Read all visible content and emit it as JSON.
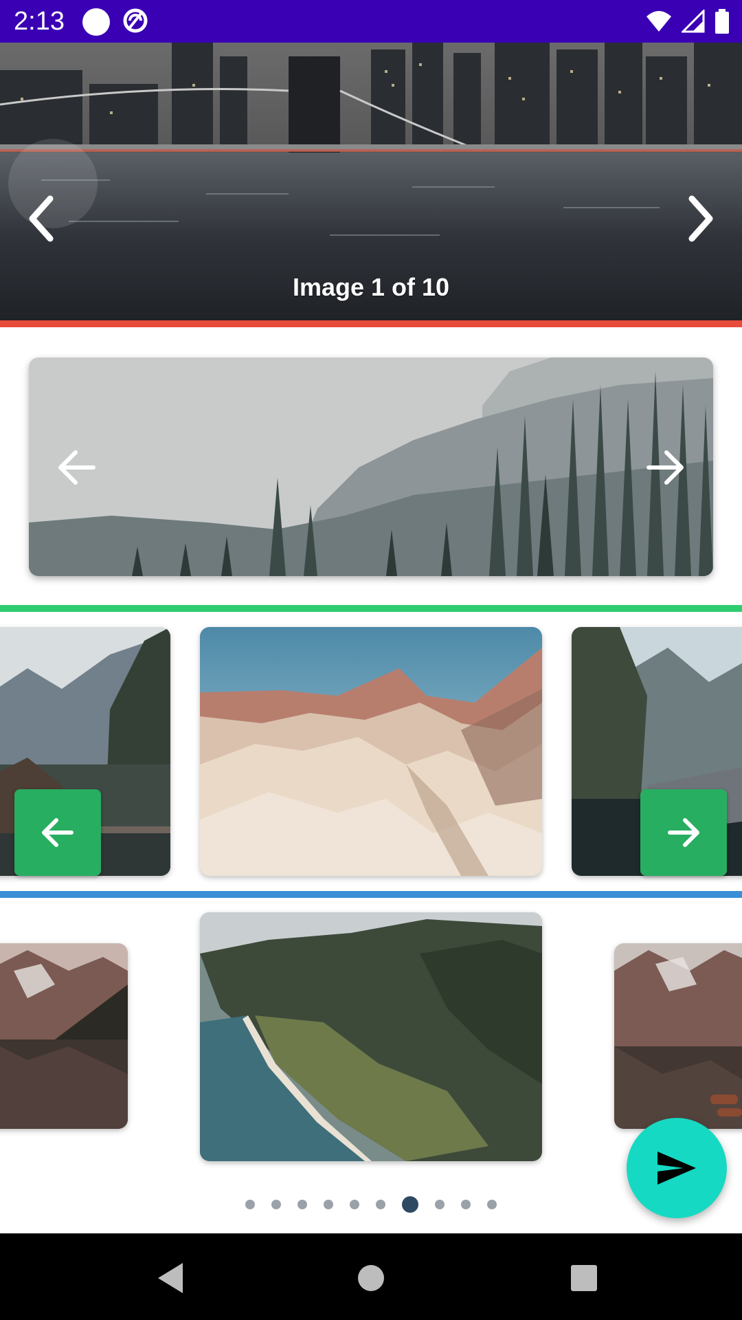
{
  "status_bar": {
    "time": "2:13",
    "background": "#3a00b4",
    "icons": [
      "circle-icon",
      "sync-icon",
      "wifi-icon",
      "signal-icon",
      "battery-icon"
    ]
  },
  "carousel_1": {
    "caption": "Image 1 of 10",
    "dots_total": 10,
    "active_dot": 1,
    "underline_color": "#e74c3c",
    "image": "city-bridge-night"
  },
  "carousel_2": {
    "image": "foggy-pine-forest",
    "underline_color": "#2ecc71"
  },
  "carousel_3": {
    "images": [
      "mountain-lake-cabin",
      "desert-badlands",
      "cliff-lake-cabin"
    ],
    "button_color": "#27ae60",
    "underline_color": "#3a8fd6"
  },
  "carousel_4": {
    "images": [
      "alpine-lake-reflection",
      "coastal-cliffs-aerial",
      "alpine-lake-boats"
    ],
    "dots_total": 10,
    "active_dot": 7,
    "active_dot_color": "#2e4a63"
  },
  "fab": {
    "icon": "send-icon",
    "color": "#16d9c3"
  },
  "nav_bar": {
    "buttons": [
      "back-icon",
      "home-icon",
      "recents-icon"
    ]
  }
}
